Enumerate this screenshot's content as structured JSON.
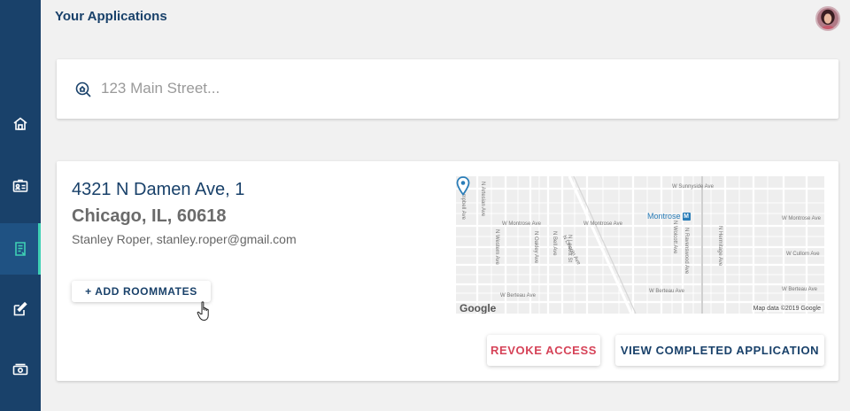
{
  "page": {
    "title": "Your Applications"
  },
  "sidebar": {
    "items": [
      {
        "name": "home",
        "icon": "home-icon"
      },
      {
        "name": "profile",
        "icon": "id-card-icon"
      },
      {
        "name": "applications",
        "icon": "document-icon",
        "active": true
      },
      {
        "name": "edit",
        "icon": "edit-icon"
      },
      {
        "name": "payments",
        "icon": "money-icon"
      }
    ]
  },
  "search": {
    "placeholder": "123 Main Street..."
  },
  "application": {
    "address_line1": "4321 N Damen Ave, 1",
    "address_line2": "Chicago, IL, 60618",
    "tenant": "Stanley Roper, stanley.roper@gmail.com",
    "add_roommates_label": "+ ADD ROOMMATES",
    "revoke_label": "REVOKE ACCESS",
    "view_label": "VIEW COMPLETED APPLICATION",
    "map": {
      "street_labels": {
        "sunnyside": "W Sunnyside Ave",
        "montrose_left": "W Montrose Ave",
        "montrose_right": "W Montrose Ave",
        "montrose_far": "W Montrose Ave",
        "berteau_left": "W Berteau Ave",
        "berteau_mid": "W Berteau Ave",
        "berteau_right": "W Berteau Ave",
        "cullom": "W Cullom Ave",
        "campbell": "N Campbell Ave",
        "artesian": "N Artesian Ave",
        "western": "N Western Ave",
        "oakley": "N Oakley Ave",
        "bell": "N Bell Ave",
        "leavitt": "N Leavitt St",
        "lincoln": "N Lincoln Ave",
        "wolcott": "N Wolcott Ave",
        "ravenswood": "N Ravenswood Ave",
        "hermitage": "N Hermitage Ave"
      },
      "station_label": "Montrose",
      "station_badge": "M",
      "logo": "Google",
      "copyright": "Map data ©2019 Google"
    }
  },
  "colors": {
    "sidebar": "#19416a",
    "sidebar_active": "#1f5283",
    "active_indicator": "#3fd0b4",
    "primary_text": "#19416a",
    "danger": "#d64358",
    "background": "#f1f1f1"
  }
}
